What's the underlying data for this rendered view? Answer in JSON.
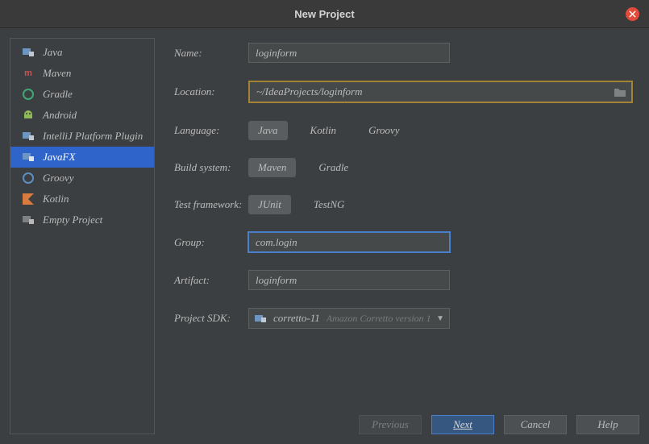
{
  "window": {
    "title": "New Project"
  },
  "sidebar": {
    "items": [
      {
        "label": "Java",
        "icon": "java-icon",
        "color": "#6e96c4"
      },
      {
        "label": "Maven",
        "icon": "maven-icon",
        "color": "#c75450"
      },
      {
        "label": "Gradle",
        "icon": "gradle-icon",
        "color": "#3fa875"
      },
      {
        "label": "Android",
        "icon": "android-icon",
        "color": "#8fb858"
      },
      {
        "label": "IntelliJ Platform Plugin",
        "icon": "plugin-icon",
        "color": "#6e96c4"
      },
      {
        "label": "JavaFX",
        "icon": "javafx-icon",
        "color": "#6e96c4",
        "selected": true
      },
      {
        "label": "Groovy",
        "icon": "groovy-icon",
        "color": "#5e8dc2"
      },
      {
        "label": "Kotlin",
        "icon": "kotlin-icon",
        "color": "#d87b3e"
      },
      {
        "label": "Empty Project",
        "icon": "empty-icon",
        "color": "#808080"
      }
    ]
  },
  "form": {
    "name_label": "Name:",
    "name_value": "loginform",
    "location_label": "Location:",
    "location_value": "~/IdeaProjects/loginform",
    "language_label": "Language:",
    "language_options": [
      "Java",
      "Kotlin",
      "Groovy"
    ],
    "language_selected": "Java",
    "build_label": "Build system:",
    "build_options": [
      "Maven",
      "Gradle"
    ],
    "build_selected": "Maven",
    "test_label": "Test framework:",
    "test_options": [
      "JUnit",
      "TestNG"
    ],
    "test_selected": "JUnit",
    "group_label": "Group:",
    "group_value": "com.login",
    "artifact_label": "Artifact:",
    "artifact_value": "loginform",
    "sdk_label": "Project SDK:",
    "sdk_value": "corretto-11",
    "sdk_sub": "Amazon Corretto version 1"
  },
  "footer": {
    "previous": "Previous",
    "next": "Next",
    "cancel": "Cancel",
    "help": "Help"
  }
}
